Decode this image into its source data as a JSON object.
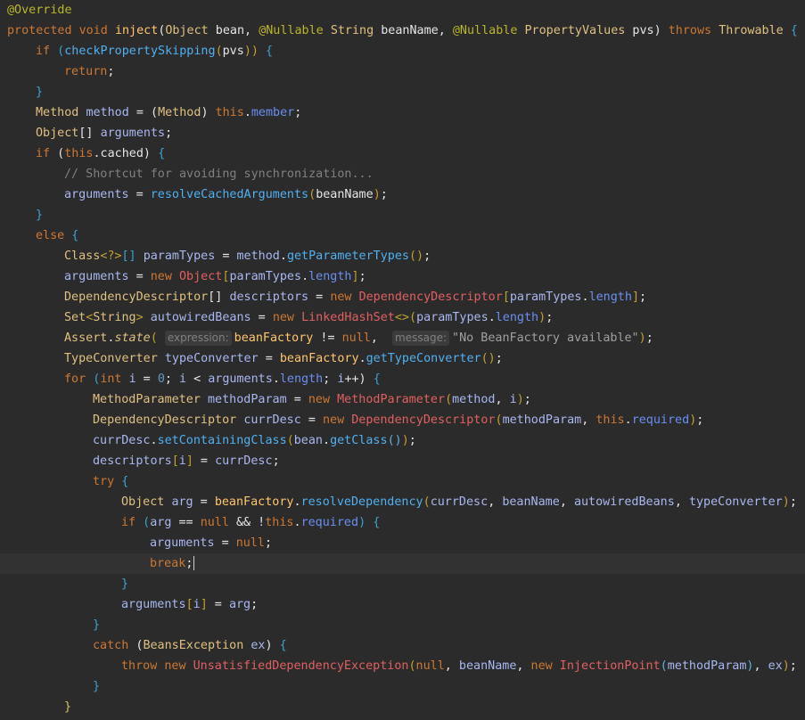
{
  "colors": {
    "background": "#2b2b2b",
    "current_line": "#323232",
    "keyword": "#cc7832",
    "plain": "#e6e6e6",
    "field": "#9876aa",
    "method": "#ffc66d",
    "string": "#6a8759",
    "number": "#6897bb",
    "comment": "#808080",
    "annotation": "#bbb529",
    "type": "#e0a070",
    "local": "#a9b7c6"
  },
  "code_lines": [
    {
      "indent": 0,
      "tokens": [
        [
          "@Override",
          "ann"
        ]
      ]
    },
    {
      "indent": 0,
      "tokens": [
        [
          "protected",
          "kw"
        ],
        [
          " ",
          "p"
        ],
        [
          "void",
          "kw"
        ],
        [
          " ",
          "p"
        ],
        [
          "inject",
          "fn"
        ],
        [
          "(",
          "p"
        ],
        [
          "Object",
          "ty"
        ],
        [
          " bean, ",
          "p"
        ],
        [
          "@Nullable",
          "ann"
        ],
        [
          " ",
          "p"
        ],
        [
          "String",
          "ty"
        ],
        [
          " beanName, ",
          "p"
        ],
        [
          "@Nullable",
          "ann"
        ],
        [
          " ",
          "p"
        ],
        [
          "PropertyValues",
          "ty"
        ],
        [
          " pvs) ",
          "p"
        ],
        [
          "throws",
          "kw"
        ],
        [
          " ",
          "p"
        ],
        [
          "Throwable",
          "ty"
        ],
        [
          " {",
          "br"
        ]
      ]
    },
    {
      "indent": 1,
      "tokens": [
        [
          "if",
          "kw"
        ],
        [
          " (",
          "br"
        ],
        [
          "checkPropertySkipping",
          "fn2"
        ],
        [
          "(",
          "br2"
        ],
        [
          "pvs",
          "p"
        ],
        [
          "))",
          "br2"
        ],
        [
          " {",
          "br"
        ]
      ]
    },
    {
      "indent": 2,
      "tokens": [
        [
          "return",
          "kw"
        ],
        [
          ";",
          "p"
        ]
      ]
    },
    {
      "indent": 1,
      "tokens": [
        [
          "}",
          "br"
        ]
      ]
    },
    {
      "indent": 1,
      "tokens": [
        [
          "Method",
          "ty"
        ],
        [
          " ",
          "p"
        ],
        [
          "method",
          "fld"
        ],
        [
          " = (",
          "p"
        ],
        [
          "Method",
          "ty"
        ],
        [
          ") ",
          "p"
        ],
        [
          "this",
          "kw"
        ],
        [
          ".",
          "p"
        ],
        [
          "member",
          "fld2"
        ],
        [
          ";",
          "p"
        ]
      ]
    },
    {
      "indent": 1,
      "tokens": [
        [
          "Object",
          "ty"
        ],
        [
          "[] ",
          "p"
        ],
        [
          "arguments",
          "fld"
        ],
        [
          ";",
          "p"
        ]
      ]
    },
    {
      "indent": 1,
      "tokens": [
        [
          "if",
          "kw"
        ],
        [
          " (",
          "p"
        ],
        [
          "this",
          "kw"
        ],
        [
          ".cached) ",
          "p"
        ],
        [
          "{",
          "br"
        ]
      ]
    },
    {
      "indent": 2,
      "tokens": [
        [
          "// Shortcut for avoiding synchronization...",
          "cm"
        ]
      ]
    },
    {
      "indent": 2,
      "tokens": [
        [
          "arguments",
          "fld"
        ],
        [
          " = ",
          "p"
        ],
        [
          "resolveCachedArguments",
          "fn2"
        ],
        [
          "(",
          "br2"
        ],
        [
          "beanName",
          "p"
        ],
        [
          ")",
          "br2"
        ],
        [
          ";",
          "p"
        ]
      ]
    },
    {
      "indent": 1,
      "tokens": [
        [
          "}",
          "br"
        ]
      ]
    },
    {
      "indent": 1,
      "tokens": [
        [
          "else",
          "kw"
        ],
        [
          " {",
          "br"
        ]
      ]
    },
    {
      "indent": 2,
      "tokens": [
        [
          "Class",
          "ty"
        ],
        [
          "<?>",
          "br2"
        ],
        [
          "[] ",
          "br"
        ],
        [
          "paramTypes",
          "fld"
        ],
        [
          " = ",
          "p"
        ],
        [
          "method",
          "fld"
        ],
        [
          ".",
          "p"
        ],
        [
          "getParameterTypes",
          "fn2"
        ],
        [
          "()",
          "br2"
        ],
        [
          ";",
          "p"
        ]
      ]
    },
    {
      "indent": 2,
      "tokens": [
        [
          "arguments",
          "fld"
        ],
        [
          " = ",
          "p"
        ],
        [
          "new",
          "kw"
        ],
        [
          " ",
          "p"
        ],
        [
          "Object",
          "ty2"
        ],
        [
          "[",
          "br2"
        ],
        [
          "paramTypes",
          "fld"
        ],
        [
          ".",
          "p"
        ],
        [
          "length",
          "fld2"
        ],
        [
          "]",
          "br2"
        ],
        [
          ";",
          "p"
        ]
      ]
    },
    {
      "indent": 2,
      "tokens": [
        [
          "DependencyDescriptor",
          "ty"
        ],
        [
          "[] ",
          "p"
        ],
        [
          "descriptors",
          "fld"
        ],
        [
          " = ",
          "p"
        ],
        [
          "new",
          "kw"
        ],
        [
          " ",
          "p"
        ],
        [
          "DependencyDescriptor",
          "ty2"
        ],
        [
          "[",
          "br2"
        ],
        [
          "paramTypes",
          "fld"
        ],
        [
          ".",
          "p"
        ],
        [
          "length",
          "fld2"
        ],
        [
          "]",
          "br2"
        ],
        [
          ";",
          "p"
        ]
      ]
    },
    {
      "indent": 2,
      "tokens": [
        [
          "Set",
          "ty"
        ],
        [
          "<",
          "br2"
        ],
        [
          "String",
          "ty"
        ],
        [
          "> ",
          "br2"
        ],
        [
          "autowiredBeans",
          "fld"
        ],
        [
          " = ",
          "p"
        ],
        [
          "new",
          "kw"
        ],
        [
          " ",
          "p"
        ],
        [
          "LinkedHashSet",
          "ty2"
        ],
        [
          "<>",
          "br2"
        ],
        [
          "(",
          "br2"
        ],
        [
          "paramTypes",
          "fld"
        ],
        [
          ".",
          "p"
        ],
        [
          "length",
          "fld2"
        ],
        [
          ")",
          "br2"
        ],
        [
          ";",
          "p"
        ]
      ]
    },
    {
      "indent": 2,
      "tokens": [
        [
          "Assert",
          "ty"
        ],
        [
          ".",
          "p"
        ],
        [
          "state",
          "it"
        ],
        [
          "( ",
          "br2"
        ],
        [
          "expression:",
          "hint"
        ],
        [
          "beanFactory",
          "fn"
        ],
        [
          " != ",
          "p"
        ],
        [
          "null",
          "kw"
        ],
        [
          ",  ",
          "p"
        ],
        [
          "message:",
          "hint"
        ],
        [
          "\"No BeanFactory available\"",
          "str"
        ],
        [
          ")",
          "br2"
        ],
        [
          ";",
          "p"
        ]
      ]
    },
    {
      "indent": 2,
      "tokens": [
        [
          "TypeConverter",
          "ty"
        ],
        [
          " ",
          "p"
        ],
        [
          "typeConverter",
          "fld"
        ],
        [
          " = ",
          "p"
        ],
        [
          "beanFactory",
          "fn"
        ],
        [
          ".",
          "p"
        ],
        [
          "getTypeConverter",
          "fn2"
        ],
        [
          "()",
          "br2"
        ],
        [
          ";",
          "p"
        ]
      ]
    },
    {
      "indent": 2,
      "tokens": [
        [
          "for",
          "kw"
        ],
        [
          " (",
          "br"
        ],
        [
          "int",
          "kw"
        ],
        [
          " ",
          "p"
        ],
        [
          "i",
          "fld"
        ],
        [
          " = ",
          "p"
        ],
        [
          "0",
          "num"
        ],
        [
          "; ",
          "p"
        ],
        [
          "i",
          "fld"
        ],
        [
          " < ",
          "p"
        ],
        [
          "arguments",
          "fld"
        ],
        [
          ".",
          "p"
        ],
        [
          "length",
          "fld2"
        ],
        [
          "; ",
          "p"
        ],
        [
          "i",
          "fld"
        ],
        [
          "++) ",
          "p"
        ],
        [
          "{",
          "br"
        ]
      ]
    },
    {
      "indent": 3,
      "tokens": [
        [
          "MethodParameter",
          "ty"
        ],
        [
          " ",
          "p"
        ],
        [
          "methodParam",
          "fld"
        ],
        [
          " = ",
          "p"
        ],
        [
          "new",
          "kw"
        ],
        [
          " ",
          "p"
        ],
        [
          "MethodParameter",
          "ty2"
        ],
        [
          "(",
          "br2"
        ],
        [
          "method",
          "fld"
        ],
        [
          ", ",
          "p"
        ],
        [
          "i",
          "fld"
        ],
        [
          ")",
          "br2"
        ],
        [
          ";",
          "p"
        ]
      ]
    },
    {
      "indent": 3,
      "tokens": [
        [
          "DependencyDescriptor",
          "ty"
        ],
        [
          " ",
          "p"
        ],
        [
          "currDesc",
          "fld"
        ],
        [
          " = ",
          "p"
        ],
        [
          "new",
          "kw"
        ],
        [
          " ",
          "p"
        ],
        [
          "DependencyDescriptor",
          "ty2"
        ],
        [
          "(",
          "br2"
        ],
        [
          "methodParam",
          "fld"
        ],
        [
          ", ",
          "p"
        ],
        [
          "this",
          "kw"
        ],
        [
          ".",
          "p"
        ],
        [
          "required",
          "fld2"
        ],
        [
          ")",
          "br2"
        ],
        [
          ";",
          "p"
        ]
      ]
    },
    {
      "indent": 3,
      "tokens": [
        [
          "currDesc",
          "fld"
        ],
        [
          ".",
          "p"
        ],
        [
          "setContainingClass",
          "fn2"
        ],
        [
          "(",
          "br2"
        ],
        [
          "bean",
          "fld"
        ],
        [
          ".",
          "p"
        ],
        [
          "getClass",
          "fn2"
        ],
        [
          "()",
          "br3"
        ],
        [
          ")",
          "br2"
        ],
        [
          ";",
          "p"
        ]
      ]
    },
    {
      "indent": 3,
      "tokens": [
        [
          "descriptors",
          "fld"
        ],
        [
          "[",
          "br2"
        ],
        [
          "i",
          "fld"
        ],
        [
          "]",
          "br2"
        ],
        [
          " = ",
          "p"
        ],
        [
          "currDesc",
          "fld"
        ],
        [
          ";",
          "p"
        ]
      ]
    },
    {
      "indent": 3,
      "tokens": [
        [
          "try",
          "kw"
        ],
        [
          " {",
          "br"
        ]
      ]
    },
    {
      "indent": 4,
      "tokens": [
        [
          "Object",
          "ty"
        ],
        [
          " ",
          "p"
        ],
        [
          "arg",
          "fld"
        ],
        [
          " = ",
          "p"
        ],
        [
          "beanFactory",
          "fn"
        ],
        [
          ".",
          "p"
        ],
        [
          "resolveDependency",
          "fn2"
        ],
        [
          "(",
          "br2"
        ],
        [
          "currDesc",
          "fld"
        ],
        [
          ", ",
          "p"
        ],
        [
          "beanName",
          "fld"
        ],
        [
          ", ",
          "p"
        ],
        [
          "autowiredBeans",
          "fld"
        ],
        [
          ", ",
          "p"
        ],
        [
          "typeConverter",
          "fld"
        ],
        [
          ")",
          "br2"
        ],
        [
          ";",
          "p"
        ]
      ]
    },
    {
      "indent": 4,
      "tokens": [
        [
          "if",
          "kw"
        ],
        [
          " (",
          "br"
        ],
        [
          "arg",
          "fld"
        ],
        [
          " == ",
          "p"
        ],
        [
          "null",
          "kw"
        ],
        [
          " && !",
          "p"
        ],
        [
          "this",
          "kw"
        ],
        [
          ".",
          "p"
        ],
        [
          "required",
          "fld2"
        ],
        [
          ") ",
          "br"
        ],
        [
          "{",
          "br"
        ]
      ]
    },
    {
      "indent": 5,
      "tokens": [
        [
          "arguments",
          "fld"
        ],
        [
          " = ",
          "p"
        ],
        [
          "null",
          "kw"
        ],
        [
          ";",
          "p"
        ]
      ]
    },
    {
      "indent": 5,
      "tokens": [
        [
          "break",
          "kw"
        ],
        [
          ";",
          "p"
        ]
      ],
      "active": true
    },
    {
      "indent": 4,
      "tokens": [
        [
          "}",
          "br"
        ]
      ]
    },
    {
      "indent": 4,
      "tokens": [
        [
          "arguments",
          "fld"
        ],
        [
          "[",
          "br2"
        ],
        [
          "i",
          "fld"
        ],
        [
          "]",
          "br2"
        ],
        [
          " = ",
          "p"
        ],
        [
          "arg",
          "fld"
        ],
        [
          ";",
          "p"
        ]
      ]
    },
    {
      "indent": 3,
      "tokens": [
        [
          "}",
          "br"
        ]
      ]
    },
    {
      "indent": 3,
      "tokens": [
        [
          "catch",
          "kw"
        ],
        [
          " (",
          "p"
        ],
        [
          "BeansException",
          "ty"
        ],
        [
          " ",
          "p"
        ],
        [
          "ex",
          "fld"
        ],
        [
          ") ",
          "p"
        ],
        [
          "{",
          "br"
        ]
      ]
    },
    {
      "indent": 4,
      "tokens": [
        [
          "throw",
          "kw"
        ],
        [
          " ",
          "p"
        ],
        [
          "new",
          "kw"
        ],
        [
          " ",
          "p"
        ],
        [
          "UnsatisfiedDependencyException",
          "ty2"
        ],
        [
          "(",
          "br2"
        ],
        [
          "null",
          "kw"
        ],
        [
          ", ",
          "p"
        ],
        [
          "beanName",
          "fld"
        ],
        [
          ", ",
          "p"
        ],
        [
          "new",
          "kw"
        ],
        [
          " ",
          "p"
        ],
        [
          "InjectionPoint",
          "ty2"
        ],
        [
          "(",
          "br3"
        ],
        [
          "methodParam",
          "fld"
        ],
        [
          ")",
          "br3"
        ],
        [
          ", ",
          "p"
        ],
        [
          "ex",
          "fld"
        ],
        [
          ")",
          "br2"
        ],
        [
          ";",
          "p"
        ]
      ]
    },
    {
      "indent": 3,
      "tokens": [
        [
          "}",
          "br"
        ]
      ]
    },
    {
      "indent": 2,
      "tokens": [
        [
          "}",
          "br4"
        ]
      ]
    }
  ]
}
